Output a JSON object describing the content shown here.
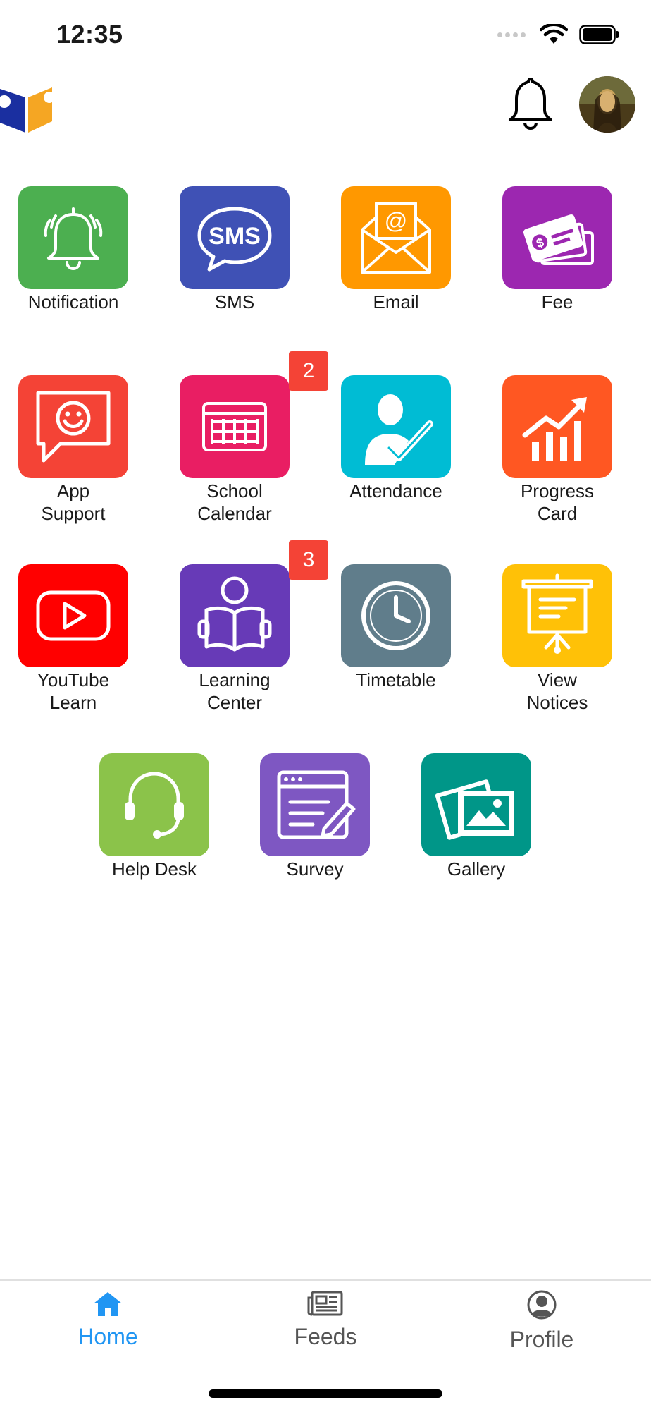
{
  "status": {
    "time": "12:35"
  },
  "grid": {
    "rows": [
      [
        {
          "label": "Notification",
          "color": "#4caf50",
          "icon": "bell-icon"
        },
        {
          "label": "SMS",
          "color": "#3f51b5",
          "icon": "sms-bubble-icon"
        },
        {
          "label": "Email",
          "color": "#ff9800",
          "icon": "envelope-icon"
        },
        {
          "label": "Fee",
          "color": "#9c27b0",
          "icon": "payment-cards-icon"
        }
      ],
      [
        {
          "label": "App\nSupport",
          "color": "#f44336",
          "icon": "smiley-chat-icon"
        },
        {
          "label": "School\nCalendar",
          "color": "#e91e63",
          "icon": "calendar-icon",
          "badge": "2"
        },
        {
          "label": "Attendance",
          "color": "#00bcd4",
          "icon": "person-check-icon"
        },
        {
          "label": "Progress\nCard",
          "color": "#ff5722",
          "icon": "growth-chart-icon"
        }
      ],
      [
        {
          "label": "YouTube\nLearn",
          "color": "#ff0000",
          "icon": "play-icon"
        },
        {
          "label": "Learning\nCenter",
          "color": "#673ab7",
          "icon": "reader-icon",
          "badge": "3"
        },
        {
          "label": "Timetable",
          "color": "#607d8b",
          "icon": "clock-icon"
        },
        {
          "label": "View\nNotices",
          "color": "#ffc107",
          "icon": "presentation-board-icon"
        }
      ],
      [
        {
          "label": "Help Desk",
          "color": "#8bc34a",
          "icon": "headset-icon"
        },
        {
          "label": "Survey",
          "color": "#7e57c2",
          "icon": "survey-form-icon"
        },
        {
          "label": "Gallery",
          "color": "#009688",
          "icon": "photos-icon"
        }
      ]
    ]
  },
  "tabs": {
    "home": {
      "label": "Home",
      "color": "#2196f3",
      "icon": "home-icon"
    },
    "feeds": {
      "label": "Feeds",
      "color": "#555555",
      "icon": "newspaper-icon"
    },
    "profile": {
      "label": "Profile",
      "color": "#555555",
      "icon": "profile-icon"
    }
  }
}
